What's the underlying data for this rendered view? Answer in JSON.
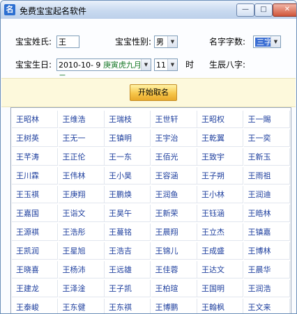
{
  "window": {
    "title": "免费宝宝起名软件"
  },
  "form": {
    "surname_label": "宝宝姓氏:",
    "surname_value": "王",
    "gender_label": "宝宝性别:",
    "gender_value": "男",
    "name_count_label": "名字字数:",
    "name_count_value": "三字",
    "birthday_label": "宝宝生日:",
    "birthday_date": "2010-10- 9",
    "birthday_lunar": "庚寅虎九月初二",
    "hour_value": "11",
    "hour_unit": "时",
    "bazi_label": "生辰八字:"
  },
  "actions": {
    "start_label": "开始取名"
  },
  "names": [
    [
      "王昭林",
      "王维浩",
      "王瑞枝",
      "王世轩",
      "王昭权",
      "王一賜"
    ],
    [
      "王树英",
      "王无一",
      "王镇明",
      "王宇治",
      "王乾翼",
      "王一奕"
    ],
    [
      "王芊涛",
      "王正伦",
      "王一东",
      "王佰光",
      "王致宇",
      "王新玉"
    ],
    [
      "王川霖",
      "王伟林",
      "王小昊",
      "王容涵",
      "王子朔",
      "王雨祖"
    ],
    [
      "王玉祺",
      "王庚翔",
      "王鹏焕",
      "王润鱼",
      "王小林",
      "王润迪"
    ],
    [
      "王嘉国",
      "王诣文",
      "王昊午",
      "王新荣",
      "王钰涵",
      "王皓林"
    ],
    [
      "王源祺",
      "王浩彤",
      "王蔓铭",
      "王晨翔",
      "王立杰",
      "王镇嘉"
    ],
    [
      "王凯润",
      "王星旭",
      "王浩吉",
      "王锦儿",
      "王成盛",
      "王博林"
    ],
    [
      "王晓喜",
      "王杨沛",
      "王远雄",
      "王佳蓉",
      "王达文",
      "王晨华"
    ],
    [
      "王建龙",
      "王泽淦",
      "王子凯",
      "王柏瑄",
      "王国明",
      "王润浩"
    ],
    [
      "王泰峻",
      "王东健",
      "王东祺",
      "王博鹏",
      "王翰枫",
      "王文来"
    ]
  ]
}
